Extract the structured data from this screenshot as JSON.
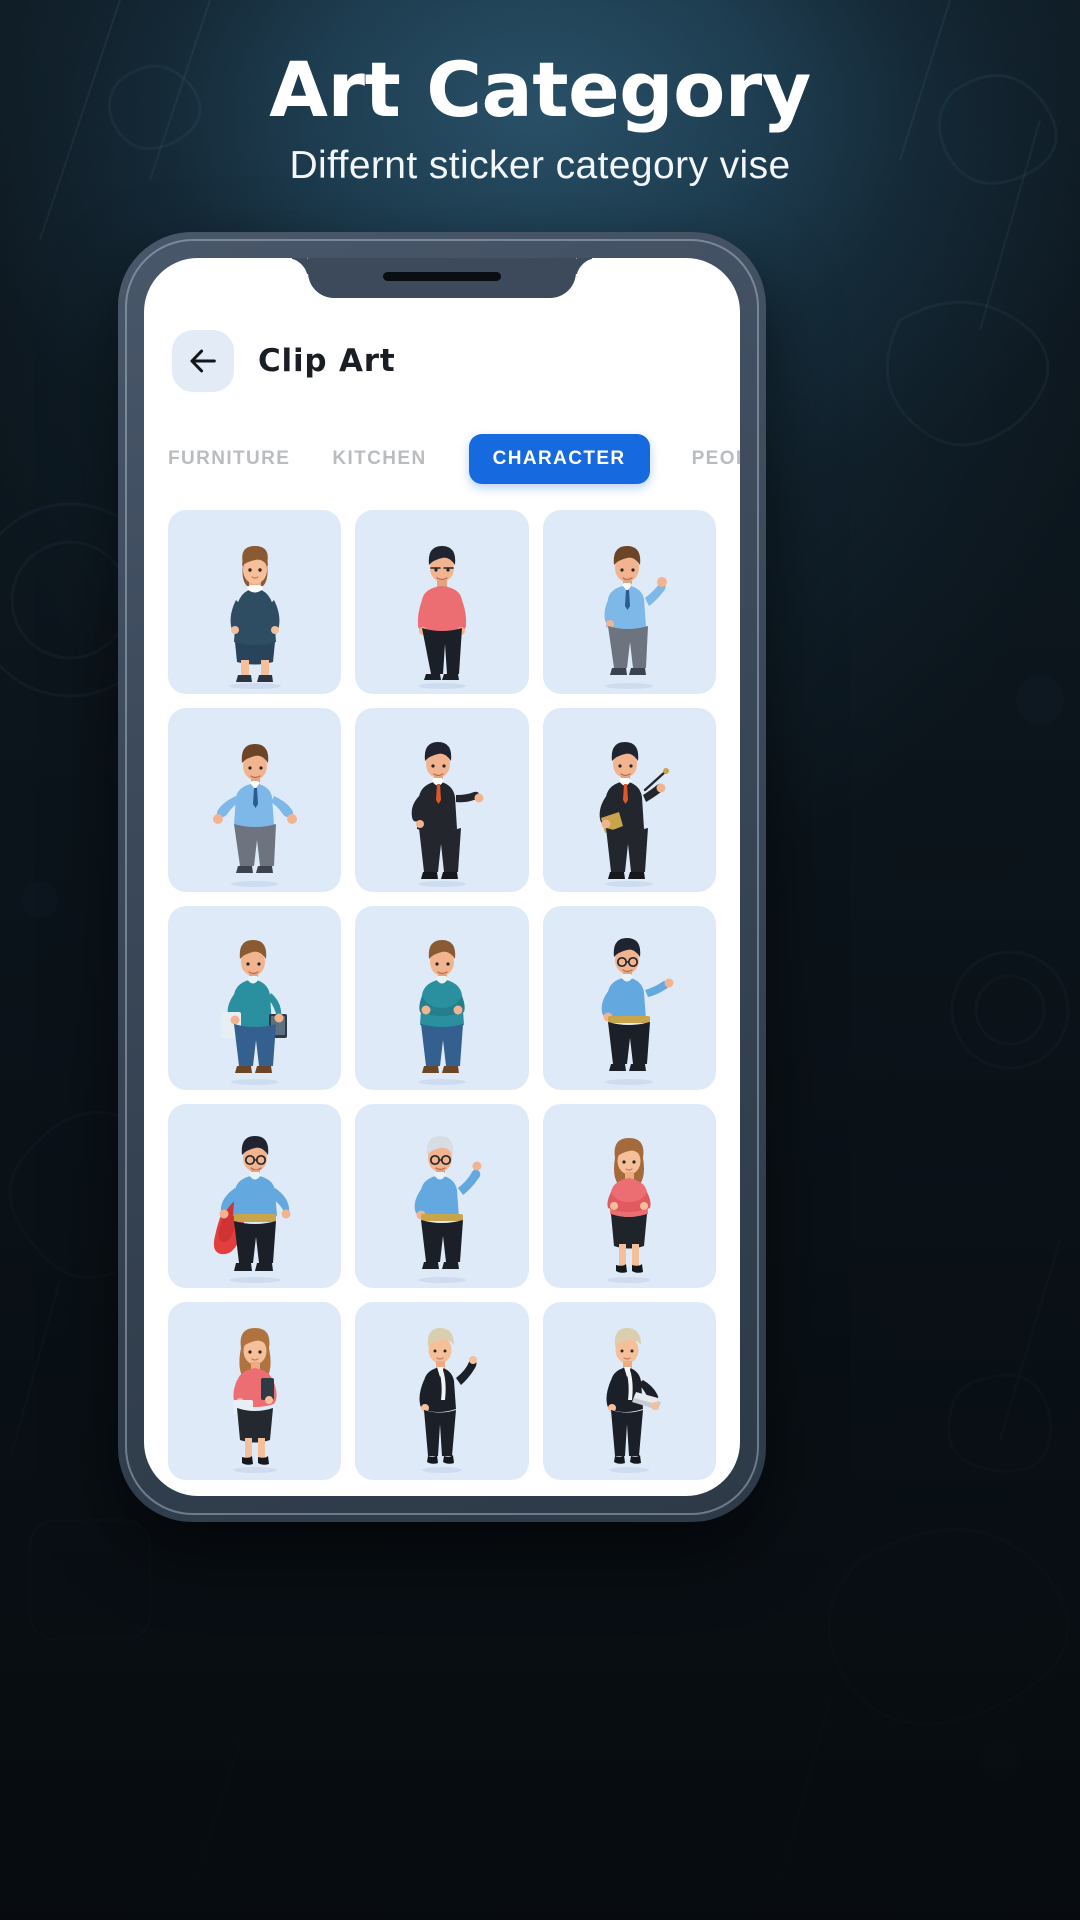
{
  "promo": {
    "title": "Art Category",
    "subtitle": "Differnt sticker category vise"
  },
  "colors": {
    "background_dark": "#0d1419",
    "background_glow": "#2b5269",
    "phone_frame": "#3c4a5c",
    "accent_blue": "#1769e0",
    "card_background": "#dfeaf9",
    "back_button_background": "#e3ebf7",
    "tab_inactive_text": "#b9bcc1",
    "title_text": "#1a1d23"
  },
  "app": {
    "appbar": {
      "back_icon": "arrow-left-icon",
      "title": "Clip Art"
    },
    "tabs": [
      {
        "label": "FURNITURE",
        "active": false
      },
      {
        "label": "KITCHEN",
        "active": false
      },
      {
        "label": "CHARACTER",
        "active": true
      },
      {
        "label": "PEOPLE",
        "active": false
      }
    ],
    "grid": {
      "columns": 3,
      "rows": 5,
      "items": [
        {
          "name": "businesswoman-navy-dress",
          "hair": "#8a5a33",
          "top": "#2e4d63",
          "bottom": "#2e4d63",
          "shoes": "#2b3440",
          "skin": "#f0b08a"
        },
        {
          "name": "man-pink-tshirt-black-pants",
          "hair": "#1f2430",
          "top": "#ec6d72",
          "bottom": "#1b1f27",
          "shoes": "#1b1f27",
          "skin": "#f2b48f"
        },
        {
          "name": "man-blue-shirt-tie-waving",
          "hair": "#6b4526",
          "top": "#7db8e8",
          "bottom": "#6d7480",
          "shoes": "#3c434f",
          "skin": "#f2b48f"
        },
        {
          "name": "man-blue-shirt-tie-shrugging",
          "hair": "#6b4526",
          "top": "#7db8e8",
          "bottom": "#6d7480",
          "shoes": "#3c434f",
          "skin": "#f2b48f"
        },
        {
          "name": "businessman-black-suit-pointing",
          "hair": "#1f2430",
          "top": "#23262d",
          "bottom": "#23262d",
          "shoes": "#15181d",
          "skin": "#f2b48f"
        },
        {
          "name": "businessman-suit-pointer-folder",
          "hair": "#1f2430",
          "top": "#23262d",
          "bottom": "#23262d",
          "shoes": "#15181d",
          "skin": "#f2b48f"
        },
        {
          "name": "man-teal-shirt-tablet",
          "hair": "#8a5a33",
          "top": "#2a8f9e",
          "bottom": "#33608f",
          "shoes": "#6b4526",
          "skin": "#f2b48f"
        },
        {
          "name": "man-teal-suit-arms-crossed",
          "hair": "#8a5a33",
          "top": "#2a8f9e",
          "bottom": "#33608f",
          "shoes": "#6b4526",
          "skin": "#f2b48f"
        },
        {
          "name": "man-glasses-blue-shirt-pointing",
          "hair": "#1f2430",
          "top": "#63a9e0",
          "bottom": "#1b1f27",
          "shoes": "#1b1f27",
          "skin": "#f2b48f"
        },
        {
          "name": "superhero-red-cape-glasses",
          "hair": "#1f2430",
          "top": "#63a9e0",
          "bottom": "#1b1f27",
          "shoes": "#1b1f27",
          "skin": "#f2b48f",
          "cape": "#e33d3d"
        },
        {
          "name": "man-glasses-blue-shirt-waving",
          "hair": "#d8dde3",
          "top": "#63a9e0",
          "bottom": "#1b1f27",
          "shoes": "#1b1f27",
          "skin": "#f2b48f"
        },
        {
          "name": "woman-pink-top-black-skirt",
          "hair": "#a56a3b",
          "top": "#ec6d72",
          "bottom": "#1f232a",
          "shoes": "#15181d",
          "skin": "#f2b48f"
        },
        {
          "name": "woman-pink-blouse-tablet",
          "hair": "#b07340",
          "top": "#ec6d72",
          "bottom": "#24282f",
          "shoes": "#15181d",
          "skin": "#f2b48f"
        },
        {
          "name": "blonde-woman-black-suit-waving",
          "hair": "#d9cfae",
          "top": "#1b1f27",
          "bottom": "#1b1f27",
          "shoes": "#15181d",
          "skin": "#f2b48f"
        },
        {
          "name": "blonde-woman-black-suit-laptop",
          "hair": "#d9cfae",
          "top": "#1b1f27",
          "bottom": "#1b1f27",
          "shoes": "#15181d",
          "skin": "#f2b48f"
        }
      ]
    }
  }
}
